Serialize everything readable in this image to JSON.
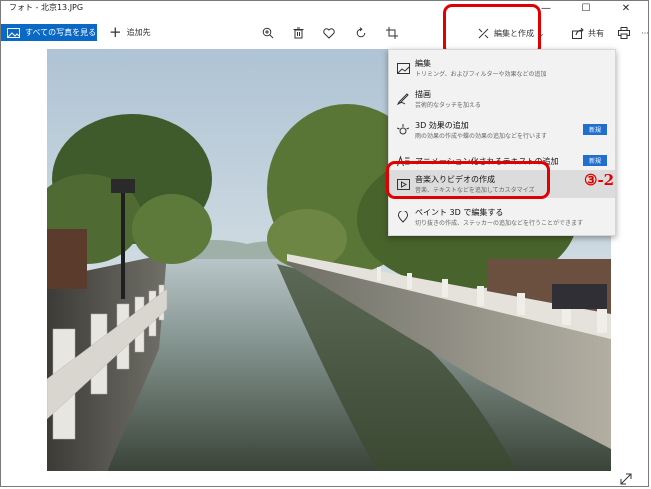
{
  "window": {
    "title": "フォト - 北京13.JPG",
    "minimize": "—",
    "maximize": "☐",
    "close": "✕"
  },
  "toolbar": {
    "all_photos_label": "すべての写真を見る",
    "add_label": "追加先",
    "add_symbol": "+",
    "icons": [
      "zoom-icon",
      "delete-icon",
      "favorite-icon",
      "rotate-icon",
      "crop-icon"
    ],
    "edit_create_label": "編集と作成",
    "edit_create_chevron": "⌄",
    "share_label": "共有",
    "print_icon": "print-icon",
    "more": "···"
  },
  "menu": {
    "items": [
      {
        "title": "編集",
        "desc": "トリミング、およびフィルターや効果などの追加",
        "badge": ""
      },
      {
        "title": "描画",
        "desc": "芸術的なタッチを加える",
        "badge": ""
      },
      {
        "title": "3D 効果の追加",
        "desc": "雨の効果の作成や蝶の効果の追加などを行います",
        "badge": "新規"
      },
      {
        "title": "アニメーション化されるテキストの追加",
        "desc": "",
        "badge": "新規"
      },
      {
        "title": "音楽入りビデオの作成",
        "desc": "音楽、テキストなどを追加してカスタマイズ",
        "badge": ""
      },
      {
        "title": "ペイント 3D で編集する",
        "desc": "切り抜きの作成、ステッカーの追加などを行うことができます",
        "badge": ""
      }
    ]
  },
  "annotation": {
    "step_label": "③-2",
    "color": "#e10000"
  },
  "colors": {
    "accent": "#0a69c4",
    "badge": "#1f6fce",
    "menu_bg": "#f2f2f2"
  }
}
